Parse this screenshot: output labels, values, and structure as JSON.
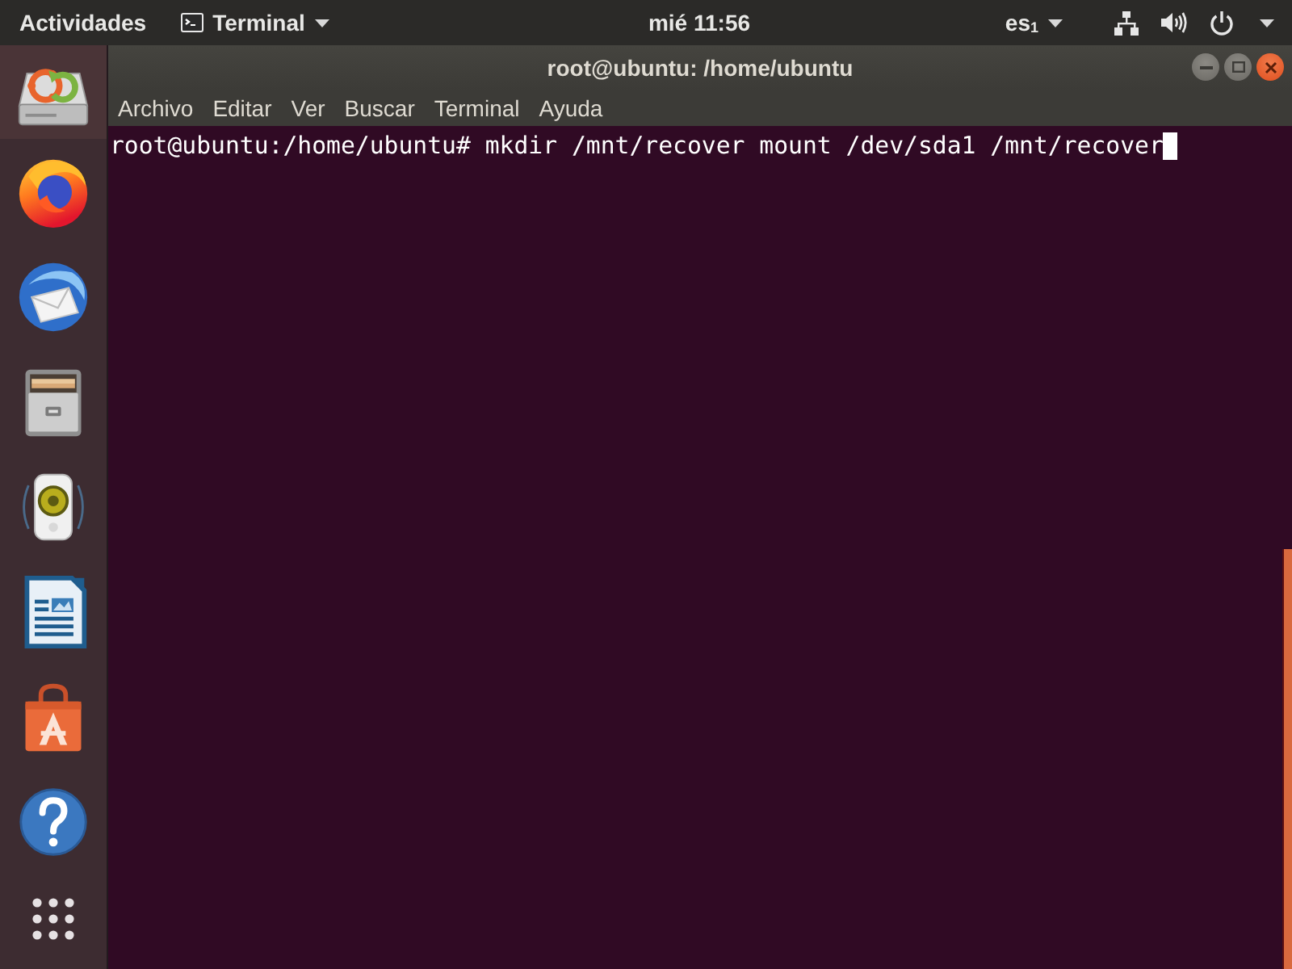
{
  "top_bar": {
    "activities": "Actividades",
    "app_menu": "Terminal",
    "clock": "mié 11:56",
    "keyboard_layout": "es$_{1}$"
  },
  "dock": {
    "items": [
      {
        "kind": "drive",
        "highlighted": true
      },
      {
        "kind": "browser",
        "highlighted": false
      },
      {
        "kind": "mail",
        "highlighted": false
      },
      {
        "kind": "files",
        "highlighted": false
      },
      {
        "kind": "music",
        "highlighted": false
      },
      {
        "kind": "writer",
        "highlighted": false
      },
      {
        "kind": "store",
        "highlighted": false
      },
      {
        "kind": "help",
        "highlighted": false
      }
    ]
  },
  "window": {
    "title": "root@ubuntu: /home/ubuntu",
    "menu": [
      "Archivo",
      "Editar",
      "Ver",
      "Buscar",
      "Terminal",
      "Ayuda"
    ]
  },
  "terminal": {
    "lines": [
      "root@ubuntu:/home/ubuntu# mkdir /mnt/recover mount /dev/sda1 /mnt/recover"
    ],
    "cursor": true
  }
}
